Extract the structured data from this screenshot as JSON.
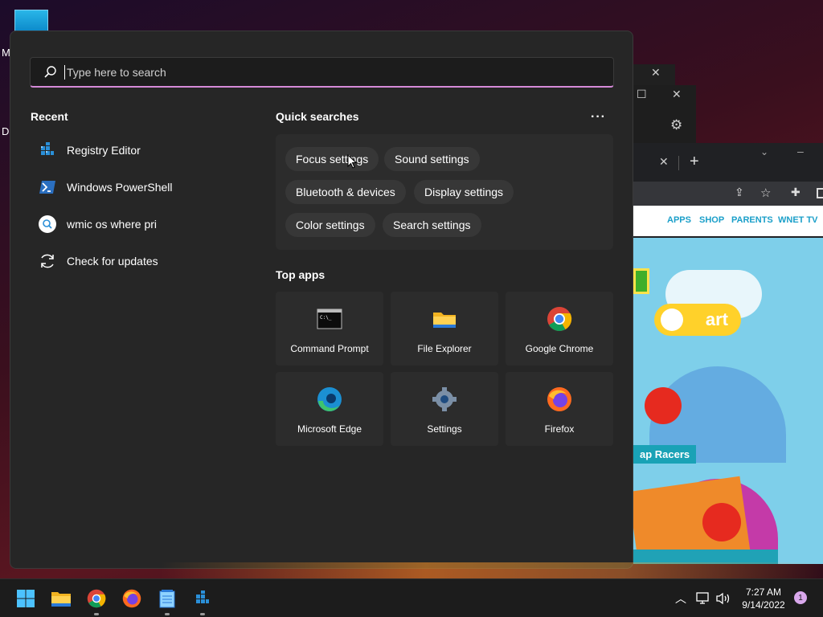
{
  "desktop": {
    "label_1": "M",
    "label_2": "Da"
  },
  "browser": {
    "nav_links": [
      "APPS",
      "SHOP",
      "PARENTS",
      "WNET TV"
    ],
    "art_label": "art",
    "racers_label": "ap Racers"
  },
  "start_menu": {
    "search": {
      "placeholder": "Type here to search"
    },
    "recent": {
      "title": "Recent",
      "items": [
        {
          "label": "Registry Editor",
          "icon": "registry-editor-icon"
        },
        {
          "label": "Windows PowerShell",
          "icon": "powershell-icon"
        },
        {
          "label": "wmic os where pri",
          "icon": "search-result-icon"
        },
        {
          "label": "Check for updates",
          "icon": "refresh-icon"
        }
      ]
    },
    "quick_searches": {
      "title": "Quick searches",
      "more": "···",
      "chips": [
        "Focus settings",
        "Sound settings",
        "Bluetooth & devices",
        "Display settings",
        "Color settings",
        "Search settings"
      ]
    },
    "top_apps": {
      "title": "Top apps",
      "apps": [
        {
          "label": "Command Prompt",
          "icon": "command-prompt-icon"
        },
        {
          "label": "File Explorer",
          "icon": "file-explorer-icon"
        },
        {
          "label": "Google Chrome",
          "icon": "chrome-icon"
        },
        {
          "label": "Microsoft Edge",
          "icon": "edge-icon"
        },
        {
          "label": "Settings",
          "icon": "settings-gear-icon"
        },
        {
          "label": "Firefox",
          "icon": "firefox-icon"
        }
      ]
    }
  },
  "taskbar": {
    "time": "7:27 AM",
    "date": "9/14/2022",
    "notification_count": "1"
  },
  "colors": {
    "accent": "#d58ad8",
    "panel": "#262626",
    "tile": "#2c2c2c",
    "chip": "#373737"
  }
}
